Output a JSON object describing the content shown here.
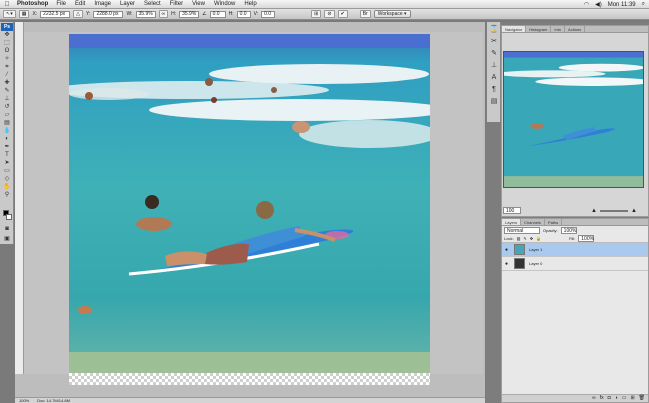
{
  "menubar": {
    "apple": "",
    "app": "Photoshop",
    "items": [
      "File",
      "Edit",
      "Image",
      "Layer",
      "Select",
      "Filter",
      "View",
      "Window",
      "Help"
    ],
    "clock": "Mon 11:39"
  },
  "options": {
    "x_value": "2232.5 px",
    "y_value": "2288.0 px",
    "w_value": "35.9%",
    "h_value": "35.9%",
    "angle_value": "0.0",
    "h_skew": "0.0",
    "v_skew": "0.0",
    "workspace_label": "Workspace ▾"
  },
  "document": {
    "status_zoom": "100%",
    "status_info": "Doc: 14.7M/14.8M"
  },
  "navigator": {
    "tabs": [
      "Navigator",
      "Histogram",
      "Info",
      "Actions"
    ],
    "zoom": "100"
  },
  "layers": {
    "tabs": [
      "Layers",
      "Channels",
      "Paths"
    ],
    "blend_mode": "Normal",
    "opacity_label": "Opacity:",
    "opacity_value": "100%",
    "lock_label": "Lock:",
    "fill_label": "Fill:",
    "fill_value": "100%",
    "items": [
      {
        "name": "Layer 1",
        "selected": true
      },
      {
        "name": "Layer 0",
        "selected": false
      }
    ]
  },
  "colors": {
    "accent_selection": "#a9c9ef",
    "nav_frame": "#c71f1f",
    "ps_blue": "#1f63b8"
  }
}
